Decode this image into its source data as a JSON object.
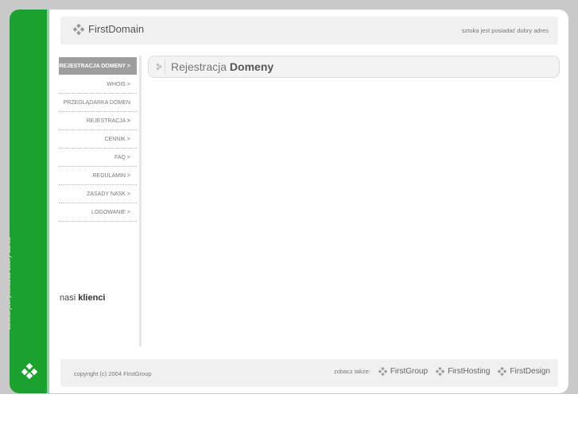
{
  "brand": {
    "name": "FirstDomain",
    "tagline": "sztuka jest posiadać dobry adres"
  },
  "nav": [
    {
      "label": "REJESTRACJA DOMENY >",
      "active": true
    },
    {
      "label": "WHOIS >"
    },
    {
      "label": "PRZEGLĄDARKA DOMEN >"
    },
    {
      "label": "REJESTRACJA >"
    },
    {
      "label": "CENNIK >"
    },
    {
      "label": "FAQ >"
    },
    {
      "label": "REGULAMIN >"
    },
    {
      "label": "ZASADY NASK >"
    },
    {
      "label": "LOGOWANIE >"
    }
  ],
  "clients": {
    "prefix": "nasi ",
    "bold": "klienci"
  },
  "content": {
    "title_plain": "Rejestracja ",
    "title_bold": "Domeny"
  },
  "footer": {
    "copyright": "copyright (c) 2004 FirstGroup",
    "see_also": "zobacz także:",
    "links": [
      "FirstGroup",
      "FirstHosting",
      "FirstDesign"
    ]
  },
  "colors": {
    "green": "#1aa12e",
    "nav_active": "#9d9d9d"
  },
  "icons": {
    "logo": "diamond-cluster-icon",
    "chevron": "chevron-right-icon"
  }
}
